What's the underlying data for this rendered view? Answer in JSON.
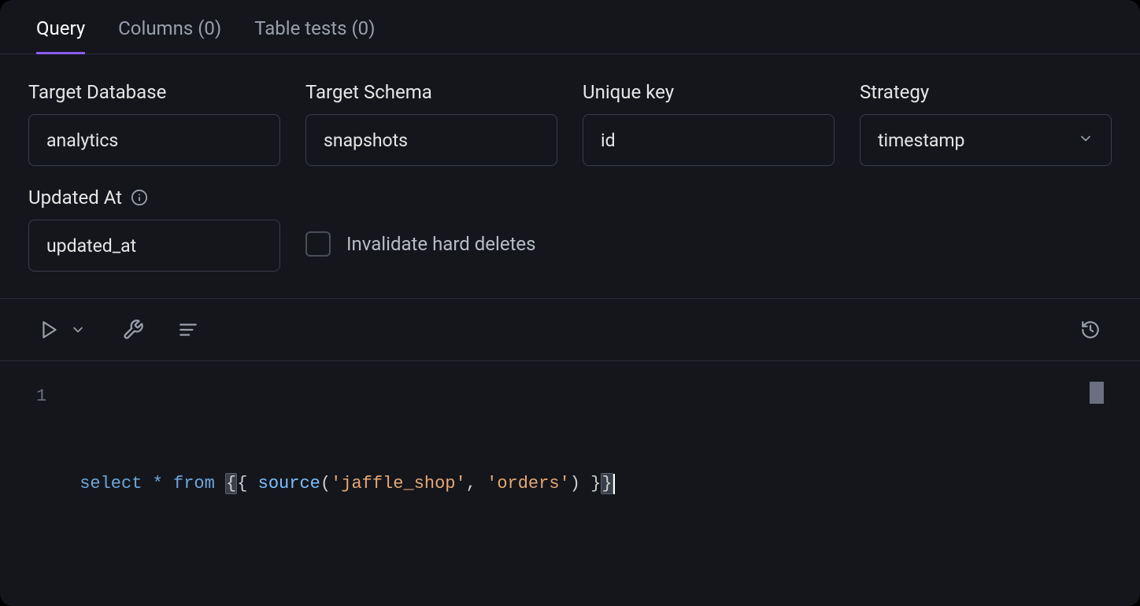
{
  "tabs": [
    {
      "label": "Query",
      "active": true
    },
    {
      "label": "Columns (0)",
      "active": false
    },
    {
      "label": "Table tests (0)",
      "active": false
    }
  ],
  "fields": {
    "target_database": {
      "label": "Target Database",
      "value": "analytics"
    },
    "target_schema": {
      "label": "Target Schema",
      "value": "snapshots"
    },
    "unique_key": {
      "label": "Unique key",
      "value": "id"
    },
    "strategy": {
      "label": "Strategy",
      "value": "timestamp"
    },
    "updated_at": {
      "label": "Updated At",
      "value": "updated_at"
    }
  },
  "checkbox": {
    "invalidate_hard_deletes": {
      "label": "Invalidate hard deletes",
      "checked": false
    }
  },
  "editor": {
    "line_number": "1",
    "code": "select * from {{ source('jaffle_shop', 'orders') }}",
    "tokens": {
      "select": "select",
      "star": "*",
      "from": "from",
      "lbrace_outer": "{",
      "lbrace_inner": "{ ",
      "source_fn": "source",
      "lparen": "(",
      "str1": "'jaffle_shop'",
      "comma": ", ",
      "str2": "'orders'",
      "rparen": ")",
      "rbrace_inner": " }",
      "rbrace_outer": "}"
    }
  }
}
